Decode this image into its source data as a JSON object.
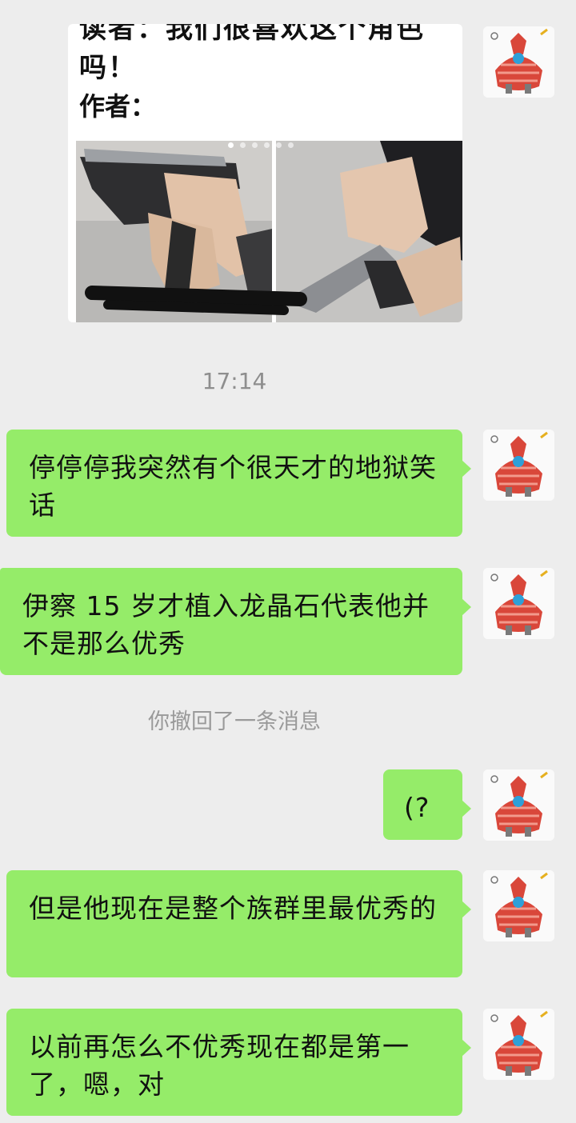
{
  "post_card": {
    "cut_text": "读者：我们很喜欢这个角色吗！",
    "author_label": "作者：",
    "page_indicator": {
      "count": 6,
      "current": 1
    }
  },
  "timestamp": "17:14",
  "messages": [
    {
      "text": "停停停我突然有个很天才的地狱笑话"
    },
    {
      "text": "伊察 15 岁才植入龙晶石代表他并不是那么优秀"
    },
    {
      "text": "(?"
    },
    {
      "text": "但是他现在是整个族群里最优秀的"
    },
    {
      "text": "以前再怎么不优秀现在都是第一了，嗯，对"
    }
  ],
  "recall_notice": "你撤回了一条消息",
  "colors": {
    "background": "#ededed",
    "bubble_self": "#95ec69",
    "system_text": "#9a9a9a"
  }
}
